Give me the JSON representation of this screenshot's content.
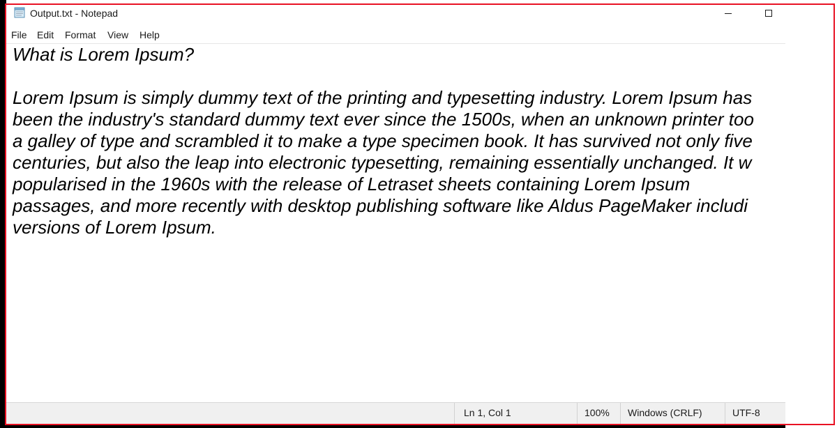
{
  "window": {
    "title": "Output.txt - Notepad",
    "app_icon": "notepad-icon",
    "controls": {
      "minimize_icon": "minimize-icon",
      "maximize_icon": "maximize-icon"
    }
  },
  "menu": {
    "items": [
      "File",
      "Edit",
      "Format",
      "View",
      "Help"
    ]
  },
  "editor": {
    "heading": "What is Lorem Ipsum?",
    "lines": [
      "Lorem Ipsum is simply dummy text of the printing and typesetting industry. Lorem Ipsum has",
      "been the industry's standard dummy text ever since the 1500s, when an unknown printer too",
      "a galley of type and scrambled it to make a type specimen book. It has survived not only five",
      "centuries, but also the leap into electronic typesetting, remaining essentially unchanged. It w",
      "popularised in the 1960s with the release of Letraset sheets containing Lorem Ipsum",
      "passages, and more recently with desktop publishing software like Aldus PageMaker includi",
      "versions of Lorem Ipsum."
    ]
  },
  "status": {
    "position": "Ln 1, Col 1",
    "zoom": "100%",
    "line_ending": "Windows (CRLF)",
    "encoding": "UTF-8"
  },
  "colors": {
    "highlight_frame": "#e81123",
    "status_bar_bg": "#f0f0f0"
  }
}
